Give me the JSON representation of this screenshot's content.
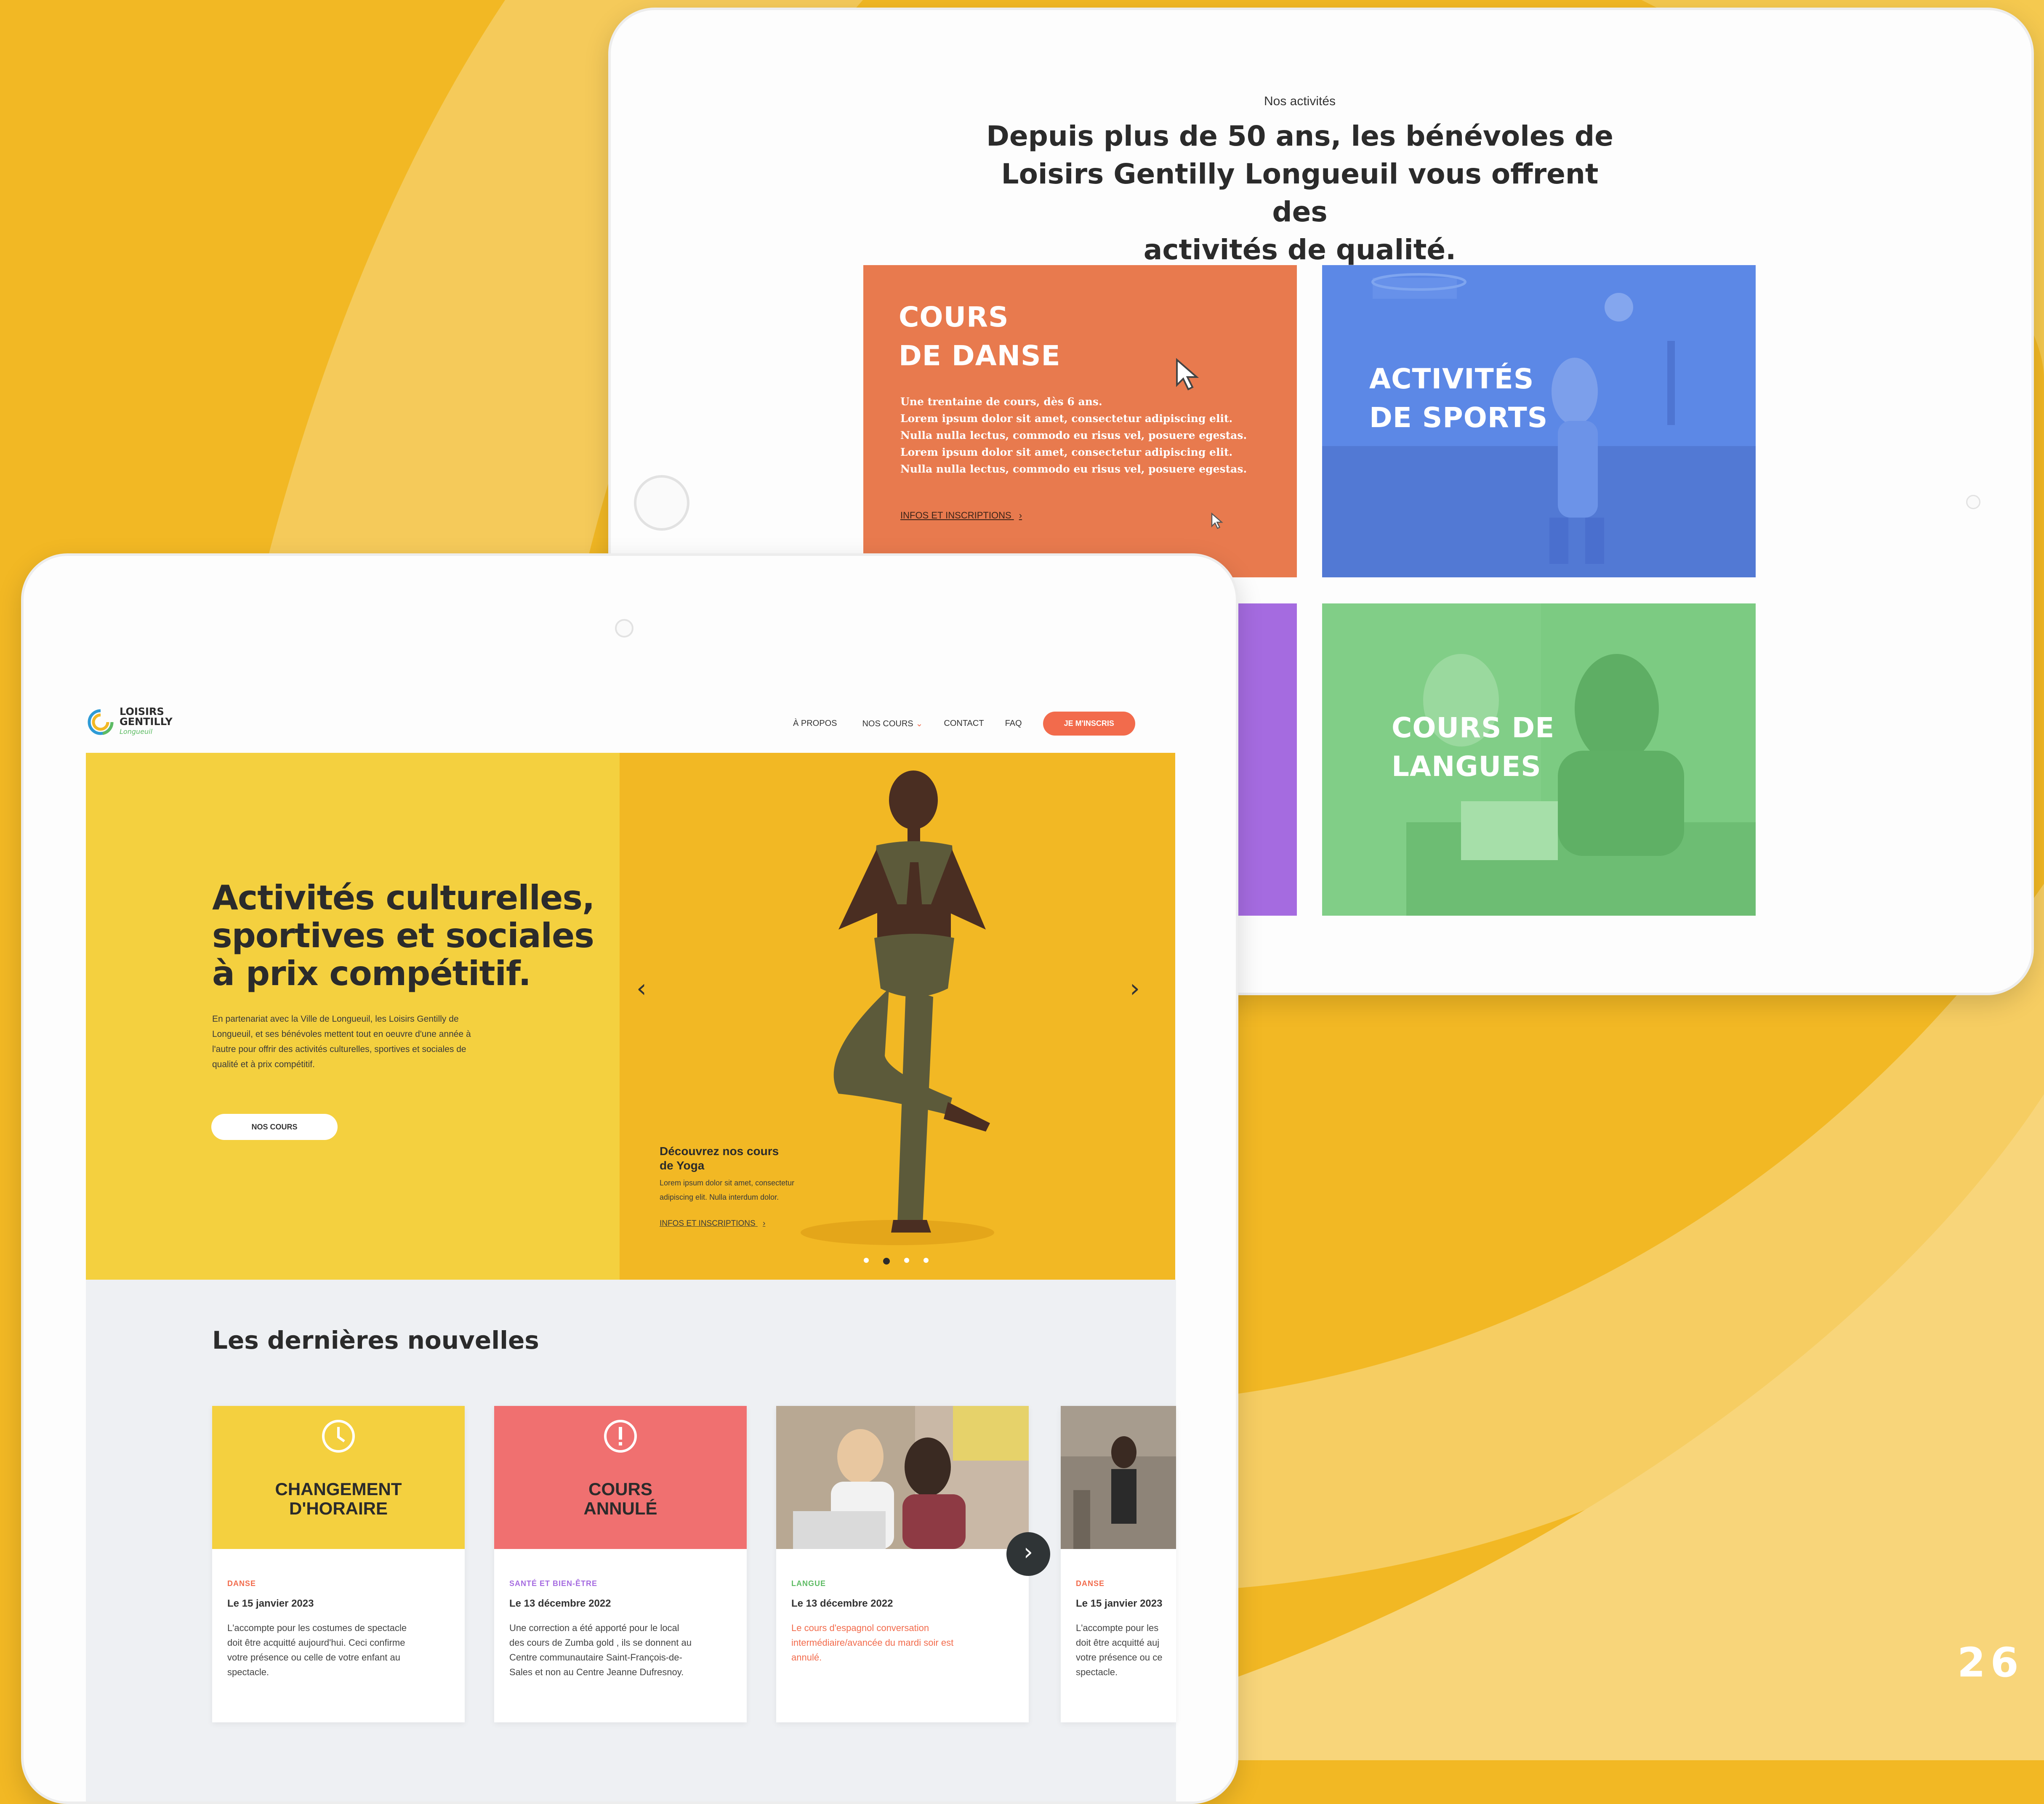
{
  "page_number": "26",
  "colors": {
    "background": "#F2B824",
    "accent_orange": "#F26B4C",
    "dance_orange": "#E87A4E",
    "sports_blue": "#5A86E4",
    "languages_green": "#78C77E",
    "purple": "#A56BE0",
    "news_yellow": "#F4D03F",
    "news_red": "#F07070"
  },
  "back_screen": {
    "eyebrow": "Nos activités",
    "heading_line1": "Depuis plus de 50 ans, les bénévoles de",
    "heading_line2": "Loisirs Gentilly Longueuil vous offrent des",
    "heading_line3": "activités de qualité.",
    "dance_card": {
      "title_line1": "COURS",
      "title_line2": "DE DANSE",
      "lines": [
        "Une trentaine de cours, dès 6 ans.",
        "Lorem ipsum dolor sit amet, consectetur adipiscing elit.",
        "Nulla nulla lectus, commodo eu risus vel, posuere egestas.",
        "Lorem ipsum dolor sit amet, consectetur adipiscing elit.",
        "Nulla nulla lectus, commodo eu risus vel, posuere egestas."
      ],
      "link": "INFOS ET INSCRIPTIONS"
    },
    "sports_card": {
      "title_line1": "ACTIVITÉS",
      "title_line2": "DE SPORTS"
    },
    "languages_card": {
      "title_line1": "COURS DE",
      "title_line2": "LANGUES"
    }
  },
  "front_screen": {
    "logo_line1": "LOISIRS",
    "logo_line2": "GENTILLY",
    "logo_line3": "Longueuil",
    "nav": {
      "about": "À PROPOS",
      "courses": "NOS COURS",
      "contact": "CONTACT",
      "faq": "FAQ",
      "cta": "JE M'INSCRIS"
    },
    "hero": {
      "title_line1": "Activités culturelles,",
      "title_line2": "sportives et sociales",
      "title_line3": "à prix compétitif.",
      "text_lines": [
        "En partenariat avec la Ville de Longueuil, les Loisirs Gentilly de",
        "Longueuil, et ses bénévoles mettent tout en oeuvre d'une année à",
        "l'autre pour offrir des activités culturelles, sportives et sociales de",
        "qualité et à prix compétitif."
      ],
      "button": "NOS COURS",
      "slide_title_line1": "Découvrez nos cours",
      "slide_title_line2": "de Yoga",
      "slide_text_line1": "Lorem ipsum dolor sit amet, consectetur",
      "slide_text_line2": "adipiscing elit. Nulla interdum dolor.",
      "slide_link": "INFOS ET INSCRIPTIONS",
      "carousel": {
        "total": 4,
        "active": 2
      }
    },
    "news": {
      "heading": "Les dernières nouvelles",
      "cards": [
        {
          "head_line1": "CHANGEMENT",
          "head_line2": "D'HORAIRE",
          "icon": "clock-icon",
          "category": "DANSE",
          "date": "Le 15 janvier 2023",
          "text_lines": [
            "L'accompte pour les costumes de spectacle",
            "doit être acquitté aujourd'hui. Ceci confirme",
            "votre présence ou celle de votre enfant au",
            "spectacle."
          ]
        },
        {
          "head_line1": "COURS",
          "head_line2": "ANNULÉ",
          "icon": "alert-icon",
          "category": "SANTÉ ET BIEN-ÊTRE",
          "date": "Le 13 décembre 2022",
          "text_lines": [
            "Une correction a été apporté pour le local",
            "des cours de Zumba gold , ils se donnent au",
            "Centre communautaire Saint-François-de-",
            "Sales et non au Centre Jeanne Dufresnoy."
          ]
        },
        {
          "category": "LANGUE",
          "date": "Le 13 décembre 2022",
          "text_lines": [
            "Le cours d'espagnol conversation",
            "intermédiaire/avancée du mardi soir est",
            "annulé."
          ]
        },
        {
          "category": "DANSE",
          "date": "Le 15 janvier 2023",
          "text_lines": [
            "L'accompte pour les",
            "doit être acquitté auj",
            "votre présence ou ce",
            "spectacle."
          ]
        }
      ]
    }
  }
}
